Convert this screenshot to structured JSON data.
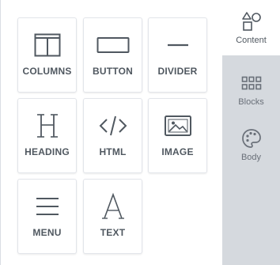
{
  "tools": [
    {
      "label": "COLUMNS",
      "icon": "columns-icon"
    },
    {
      "label": "BUTTON",
      "icon": "button-icon"
    },
    {
      "label": "DIVIDER",
      "icon": "divider-icon"
    },
    {
      "label": "HEADING",
      "icon": "heading-icon"
    },
    {
      "label": "HTML",
      "icon": "html-code-icon"
    },
    {
      "label": "IMAGE",
      "icon": "image-icon"
    },
    {
      "label": "MENU",
      "icon": "menu-icon"
    },
    {
      "label": "TEXT",
      "icon": "text-icon"
    }
  ],
  "tabs": [
    {
      "label": "Content",
      "icon": "shapes-icon",
      "active": true
    },
    {
      "label": "Blocks",
      "icon": "blocks-grid-icon",
      "active": false
    },
    {
      "label": "Body",
      "icon": "palette-icon",
      "active": false
    }
  ],
  "colors": {
    "icon": "#505860",
    "rail_background": "#d5d9de",
    "tile_border": "#e2e5ea"
  }
}
